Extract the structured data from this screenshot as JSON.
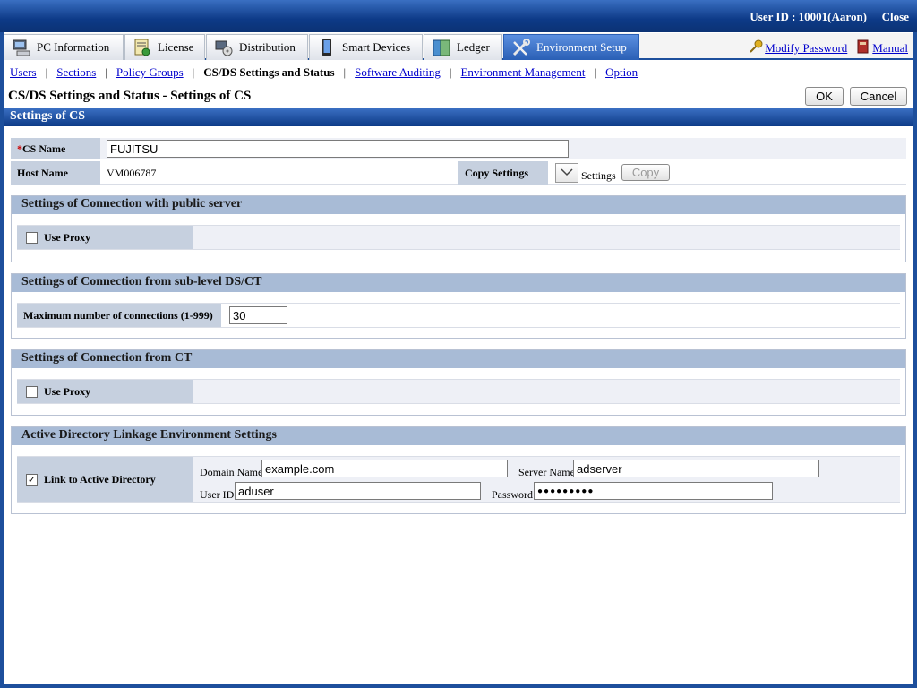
{
  "header": {
    "user_id": "User ID : 10001(Aaron)",
    "close_label": "Close"
  },
  "tabs": [
    {
      "label": "PC Information",
      "icon": "pc-icon"
    },
    {
      "label": "License",
      "icon": "license-icon"
    },
    {
      "label": "Distribution",
      "icon": "distribution-icon"
    },
    {
      "label": "Smart Devices",
      "icon": "smart-device-icon"
    },
    {
      "label": "Ledger",
      "icon": "ledger-icon"
    },
    {
      "label": "Environment Setup",
      "icon": "tools-icon",
      "active": true
    }
  ],
  "top_links": {
    "modify_password": "Modify Password",
    "manual": "Manual"
  },
  "subnav": {
    "users": "Users",
    "sections": "Sections",
    "policy_groups": "Policy Groups",
    "csds": "CS/DS Settings and Status",
    "software_auditing": "Software Auditing",
    "env_mgmt": "Environment Management",
    "option": "Option"
  },
  "page": {
    "title": "CS/DS Settings and Status - Settings of CS",
    "ok": "OK",
    "cancel": "Cancel",
    "section": "Settings of CS"
  },
  "cs": {
    "name_req": "*",
    "name_label": "CS Name",
    "name_value": "FUJITSU",
    "host_label": "Host Name",
    "host_value": "VM006787",
    "copy_label": "Copy Settings",
    "copy_settings_text": "Settings",
    "copy_button": "Copy"
  },
  "public_server": {
    "title": "Settings of Connection with public server",
    "use_proxy": "Use Proxy"
  },
  "sublevel": {
    "title": "Settings of Connection from sub-level DS/CT",
    "max_label": "Maximum number of connections (1-999)",
    "max_value": "30"
  },
  "from_ct": {
    "title": "Settings of Connection from CT",
    "use_proxy": "Use Proxy"
  },
  "ad": {
    "title": "Active Directory Linkage Environment Settings",
    "link_label": "Link to Active Directory",
    "domain_label": "Domain Name",
    "domain_value": "example.com",
    "server_label": "Server Name",
    "server_value": "adserver",
    "user_label": "User ID",
    "user_value": "aduser",
    "password_label": "Password",
    "password_value": "●●●●●●●●●"
  }
}
